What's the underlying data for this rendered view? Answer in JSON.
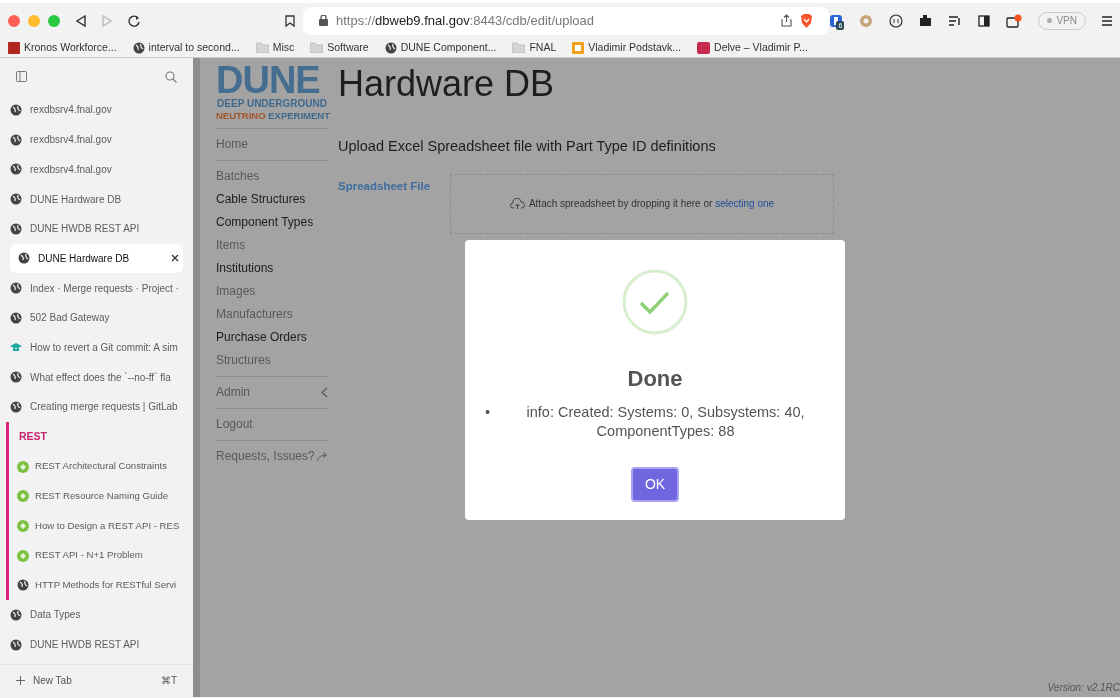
{
  "browser": {
    "url_prefix": "https://",
    "url_host": "dbweb9.fnal.gov",
    "url_rest": ":8443/cdb/edit/upload",
    "extension_badge": "6",
    "vpn_label": "VPN",
    "forward_disabled": true
  },
  "bookmarks": [
    {
      "label": "Kronos Workforce...",
      "kind": "pr"
    },
    {
      "label": "interval to second...",
      "kind": "globe"
    },
    {
      "label": "Misc",
      "kind": "folder"
    },
    {
      "label": "Software",
      "kind": "folder"
    },
    {
      "label": "DUNE Component...",
      "kind": "globe"
    },
    {
      "label": "FNAL",
      "kind": "folder"
    },
    {
      "label": "Vladimir Podstavk...",
      "kind": "office"
    },
    {
      "label": "Delve – Vladimir P...",
      "kind": "delve"
    }
  ],
  "sidebar": {
    "items": [
      {
        "label": "rexdbsrv4.fnal.gov",
        "kind": "globe",
        "selected": false
      },
      {
        "label": "rexdbsrv4.fnal.gov",
        "kind": "globe",
        "selected": false
      },
      {
        "label": "rexdbsrv4.fnal.gov",
        "kind": "globe",
        "selected": false
      },
      {
        "label": "DUNE Hardware DB",
        "kind": "globe",
        "selected": false
      },
      {
        "label": "DUNE HWDB REST API",
        "kind": "globe",
        "selected": false
      },
      {
        "label": "DUNE Hardware DB",
        "kind": "globe",
        "selected": true
      },
      {
        "label": "Index · Merge requests · Project ·",
        "kind": "globe",
        "selected": false
      },
      {
        "label": "502 Bad Gateway",
        "kind": "globe",
        "selected": false
      },
      {
        "label": "How to revert a Git commit: A sim",
        "kind": "cap",
        "selected": false
      },
      {
        "label": "What effect does the `--no-ff` fla",
        "kind": "globe",
        "selected": false
      },
      {
        "label": "Creating merge requests | GitLab",
        "kind": "globe",
        "selected": false
      },
      {
        "label": "REST",
        "kind": "group",
        "children": [
          {
            "label": "REST Architectural Constraints",
            "kind": "green",
            "selected": false
          },
          {
            "label": "REST Resource Naming Guide",
            "kind": "green",
            "selected": false
          },
          {
            "label": "How to Design a REST API - RES",
            "kind": "green",
            "selected": false
          },
          {
            "label": "REST API - N+1 Problem",
            "kind": "green",
            "selected": false
          },
          {
            "label": "HTTP Methods for RESTful Servi",
            "kind": "globe",
            "selected": false
          }
        ]
      },
      {
        "label": "Data Types",
        "kind": "globe",
        "selected": false
      },
      {
        "label": "DUNE HWDB REST API",
        "kind": "globe",
        "selected": false
      }
    ],
    "new_tab": {
      "label": "New Tab",
      "shortcut": "⌘T"
    }
  },
  "page": {
    "logo": {
      "mark": "DUNE",
      "line_1": "DEEP UNDERGROUND",
      "line_2_a": "NEUTRINO",
      "line_2_b": "EXPERIMENT"
    },
    "title": "Hardware DB",
    "nav_groups": [
      [
        {
          "label": "Home",
          "visited": false
        }
      ],
      [
        {
          "label": "Batches",
          "visited": false
        },
        {
          "label": "Cable Structures",
          "visited": true
        },
        {
          "label": "Component Types",
          "visited": true
        },
        {
          "label": "Items",
          "visited": false
        },
        {
          "label": "Institutions",
          "visited": true
        },
        {
          "label": "Images",
          "visited": false
        },
        {
          "label": "Manufacturers",
          "visited": false
        },
        {
          "label": "Purchase Orders",
          "visited": true
        },
        {
          "label": "Structures",
          "visited": false
        }
      ],
      [
        {
          "label": "Admin",
          "visited": false,
          "kind": "submenu"
        }
      ],
      [
        {
          "label": "Logout",
          "visited": false
        }
      ],
      [
        {
          "label": "Requests, Issues?",
          "visited": false,
          "kind": "external"
        }
      ]
    ],
    "heading": "Upload Excel Spreadsheet file with Part Type ID definitions",
    "field_label": "Spreadsheet File",
    "dropzone_text": "Attach spreadsheet by dropping it here or",
    "dropzone_link": "selecting one",
    "version": "Version: v2.1RC"
  },
  "dialog": {
    "title": "Done",
    "bullet": "•",
    "messages": [
      "info: Created: Systems: 0, Subsystems: 40, ComponentTypes: 88"
    ],
    "button": "OK"
  }
}
